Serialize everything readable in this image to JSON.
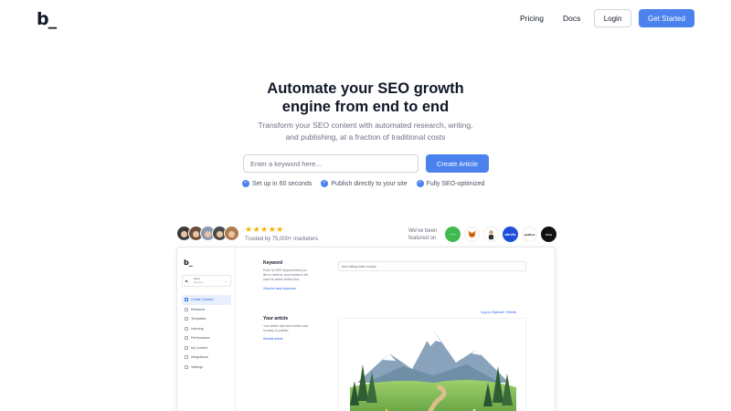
{
  "brand": {
    "logo_text": "b_"
  },
  "nav": {
    "pricing": "Pricing",
    "docs": "Docs",
    "login": "Login",
    "get_started": "Get Started"
  },
  "hero": {
    "title_line1": "Automate your SEO growth",
    "title_line2": "engine from end to end",
    "subtitle_line1": "Transform your SEO content with automated research, writing,",
    "subtitle_line2": "and publishing, at a fraction of traditional costs",
    "keyword_placeholder": "Enter a keyword here...",
    "cta": "Create Article",
    "features": [
      "Set up in 60 seconds",
      "Publish directly to your site",
      "Fully SEO-optimized"
    ]
  },
  "social_proof": {
    "stars": "★★★★★",
    "rating": 5,
    "trusted": "Trusted by 75,000+ marketers",
    "featured_line1": "We've been",
    "featured_line2": "featured on",
    "media": [
      {
        "name": "Bloom",
        "color": "#3fb950"
      },
      {
        "name": "Fox",
        "color": "#ffffff"
      },
      {
        "name": "Person",
        "color": "#ffffff"
      },
      {
        "name": "ahrefs",
        "color": "#1f4fd8"
      },
      {
        "name": "webflow",
        "color": "#ffffff"
      },
      {
        "name": "Dark",
        "color": "#111111"
      }
    ]
  },
  "preview": {
    "logo": "b_",
    "workspace_logo": "b_",
    "workspace_name": "Acme",
    "workspace_sub": "Business",
    "sidebar": [
      "Create Content",
      "Research",
      "Templates",
      "Indexing",
      "Performance",
      "My Content",
      "Integrations",
      "Settings"
    ],
    "keyword_heading": "Keyword",
    "keyword_desc_1": "Enter an SEO keyword that you",
    "keyword_desc_2": "like to rank for, your keyword will",
    "keyword_desc_3": "have its article written first.",
    "keyword_link": "View the best keywords",
    "keyword_value": "best hiking trails europe",
    "article_heading": "Your article",
    "article_desc_1": "Your article has been written and",
    "article_desc_2": "is ready to publish.",
    "article_link": "Rewrite article",
    "copy_label": "Copy to Clipboard · Rewrite"
  },
  "colors": {
    "accent": "#4b82ee",
    "star": "#f5b400"
  }
}
